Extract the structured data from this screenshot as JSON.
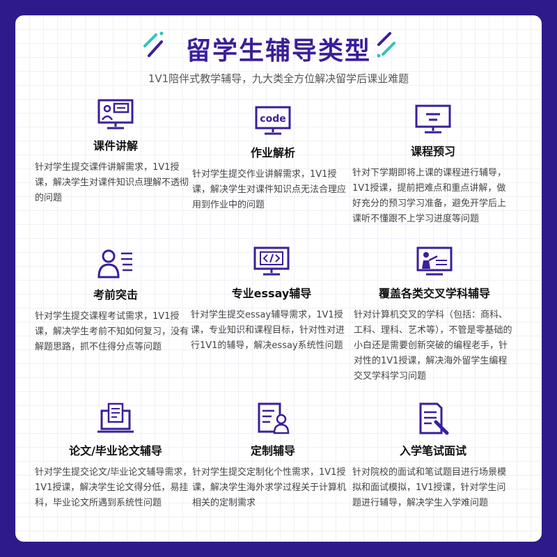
{
  "header": {
    "title": "留学生辅导类型",
    "subtitle": "1V1陪伴式教学辅导，九大类全方位解决留学后课业难题"
  },
  "accent": "#3a1f9a",
  "items": [
    {
      "title": "课件讲解",
      "icon": "courseware-presentation-icon",
      "desc": "针对学生提交课件讲解需求，1V1授课，解决学生对课件知识点理解不透彻的问题"
    },
    {
      "title": "作业解析",
      "icon": "code-monitor-icon",
      "icon_text": "code",
      "desc": "针对学生提交作业讲解需求，1V1授课，解决学生对课件知识点无法合理应用到作业中的问题"
    },
    {
      "title": "课程预习",
      "icon": "monitor-lesson-icon",
      "desc": "针对下学期即将上课的课程进行辅导，1V1授课，提前把难点和重点讲解，做好充分的预习学习准备，避免开学后上课听不懂跟不上学习进度等问题"
    },
    {
      "title": "考前突击",
      "icon": "student-notes-icon",
      "desc": "针对学生提交课程考试需求，1V1授课，解决学生考前不知如何复习，没有解题思路，抓不住得分点等问题"
    },
    {
      "title": "专业essay辅导",
      "icon": "code-brackets-monitor-icon",
      "desc": "针对学生提交essay辅导需求，1V1授课，专业知识和课程目标，针对性对进行1V1的辅导，解决essay系统性问题"
    },
    {
      "title": "覆盖各类交叉学科辅导",
      "icon": "teacher-blackboard-icon",
      "desc": "针对计算机交叉的学科（包括：商科、工科、理科、艺术等），不管是零基础的小白还是需要创新突破的编程老手，针对性的1V1授课，解决海外留学生编程交叉学科学习问题"
    },
    {
      "title": "论文/毕业论文辅导",
      "icon": "laptop-document-icon",
      "desc": "针对学生提交论文/毕业论文辅导需求，1V1授课，解决学生论文得分低，易挂科，毕业论文所遇到系统性问题"
    },
    {
      "title": "定制辅导",
      "icon": "custom-profile-document-icon",
      "desc": "针对学生提交定制化个性需求，1V1授课，解决学生海外求学过程关于计算机相关的定制需求"
    },
    {
      "title": "入学笔试面试",
      "icon": "exam-paper-pen-icon",
      "desc": "针对院校的面试和笔试题目进行场景模拟和面试模拟，1V1授课，针对学生问题进行辅导，解决学生入学难问题"
    }
  ]
}
